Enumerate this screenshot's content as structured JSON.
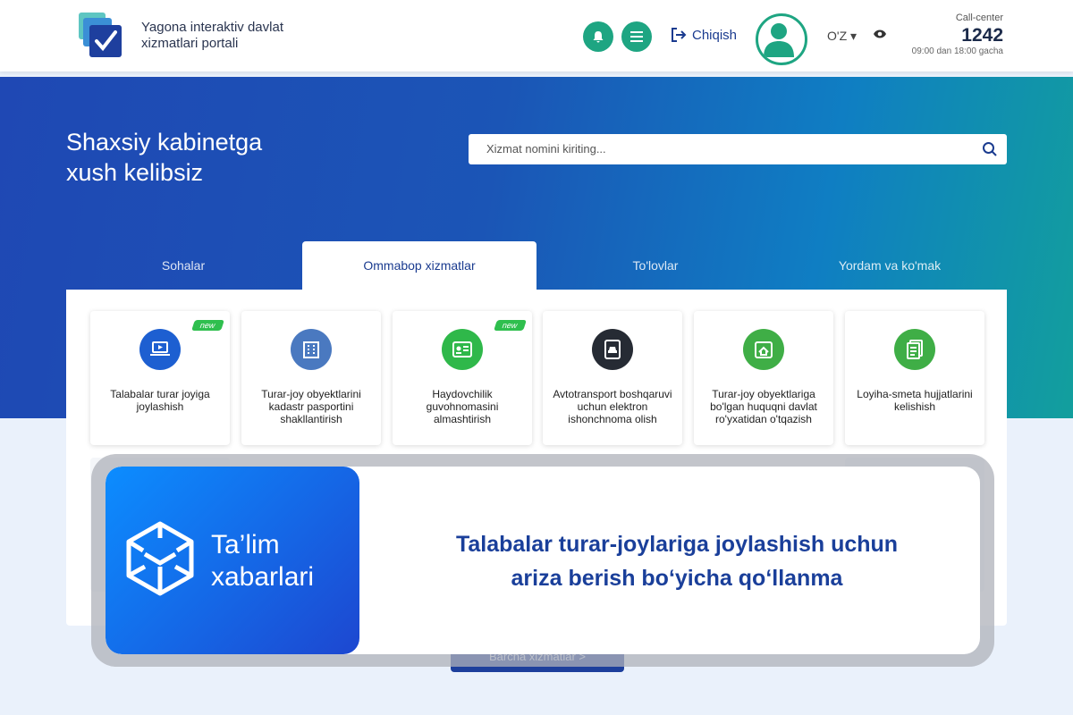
{
  "header": {
    "portal_name_line1": "Yagona interaktiv davlat",
    "portal_name_line2": "xizmatlari portali",
    "logout_label": "Chiqish",
    "language": "O'Z",
    "call_center_label": "Call-center",
    "call_center_number": "1242",
    "call_center_hours": "09:00 dan 18:00 gacha"
  },
  "hero": {
    "title_line1": "Shaxsiy kabinetga",
    "title_line2": "xush kelibsiz"
  },
  "search": {
    "placeholder": "Xizmat nomini kiriting..."
  },
  "tabs": [
    {
      "label": "Sohalar"
    },
    {
      "label": "Ommabop xizmatlar"
    },
    {
      "label": "To'lovlar"
    },
    {
      "label": "Yordam va ko'mak"
    }
  ],
  "active_tab_index": 1,
  "services": [
    {
      "label": "Talabalar turar joyiga joylashish",
      "badge": "new",
      "icon": "laptop-play-icon",
      "color": "#1d5fd1"
    },
    {
      "label": "Turar-joy obyektlarini kadastr pasportini shakllantirish",
      "badge": "",
      "icon": "building-icon",
      "color": "#4a79c0"
    },
    {
      "label": "Haydovchilik guvohnomasini almashtirish",
      "badge": "new",
      "icon": "license-card-icon",
      "color": "#2fb84a"
    },
    {
      "label": "Avtotransport boshqaruvi uchun elektron ishonchnoma olish",
      "badge": "",
      "icon": "car-document-icon",
      "color": "#262b34"
    },
    {
      "label": "Turar-joy obyektlariga bo'lgan huquqni davlat ro'yxatidan o'tqazish",
      "badge": "",
      "icon": "house-register-icon",
      "color": "#3fae46"
    },
    {
      "label": "Loyiha-smeta hujjatlarini kelishish",
      "badge": "",
      "icon": "documents-icon",
      "color": "#3fae46"
    }
  ],
  "all_services_button": "Barcha xizmatlar >",
  "overlay": {
    "brand_line1": "Ta’lim",
    "brand_line2": "xabarlari",
    "title_line1": "Talabalar turar-joylariga joylashish uchun",
    "title_line2": "ariza berish bo‘yicha qo‘llanma"
  },
  "colors": {
    "accent_green": "#1ea582",
    "primary_blue": "#1d3f9c",
    "badge_green": "#2fbf4e"
  }
}
